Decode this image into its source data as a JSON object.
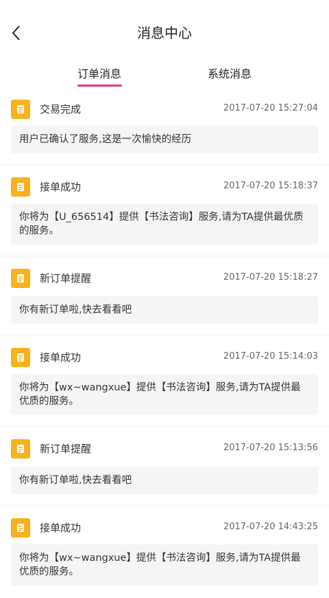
{
  "header": {
    "title": "消息中心"
  },
  "tabs": {
    "order": "订单消息",
    "system": "系统消息"
  },
  "messages": [
    {
      "title": "交易完成",
      "time": "2017-07-20 15:27:04",
      "text": "用户已确认了服务,这是一次愉快的经历"
    },
    {
      "title": "接单成功",
      "time": "2017-07-20 15:18:37",
      "text": "你将为【U_656514】提供【书法咨询】服务,请为TA提供最优质的服务。"
    },
    {
      "title": "新订单提醒",
      "time": "2017-07-20 15:18:27",
      "text": "你有新订单啦,快去看看吧"
    },
    {
      "title": "接单成功",
      "time": "2017-07-20 15:14:03",
      "text": "你将为【wx~wangxue】提供【书法咨询】服务,请为TA提供最优质的服务。"
    },
    {
      "title": "新订单提醒",
      "time": "2017-07-20 15:13:56",
      "text": "你有新订单啦,快去看看吧"
    },
    {
      "title": "接单成功",
      "time": "2017-07-20 14:43:25",
      "text": "你将为【wx~wangxue】提供【书法咨询】服务,请为TA提供最优质的服务。"
    }
  ],
  "colors": {
    "accent": "#e9356a",
    "icon_bg": "#f8b21d",
    "bubble_bg": "#f5f5f5"
  }
}
